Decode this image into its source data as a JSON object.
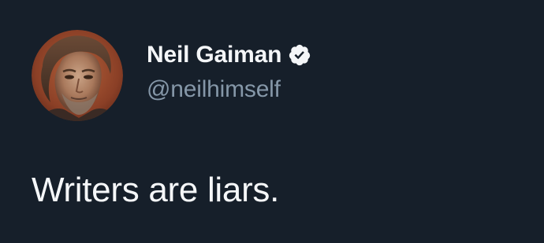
{
  "tweet": {
    "author": {
      "display_name": "Neil Gaiman",
      "handle": "@neilhimself",
      "verified": true,
      "verified_icon": "verified-badge-icon",
      "avatar_icon": "profile-portrait"
    },
    "text": "Writers are liars."
  },
  "colors": {
    "background": "#161f2a",
    "name": "#f4f6f8",
    "handle": "#8597a8",
    "text": "#f5f7f9",
    "badge": "#f4f6f8"
  }
}
